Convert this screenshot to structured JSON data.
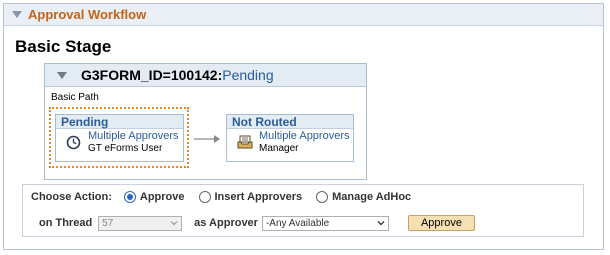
{
  "section": {
    "title": "Approval Workflow"
  },
  "stage": {
    "title": "Basic Stage"
  },
  "path": {
    "id": "G3FORM_ID=100142:",
    "status": "Pending",
    "label": "Basic Path"
  },
  "steps": [
    {
      "status": "Pending",
      "link": "Multiple Approvers",
      "sub": "GT eForms User",
      "icon": "clock-icon"
    },
    {
      "status": "Not Routed",
      "link": "Multiple Approvers",
      "sub": "Manager",
      "icon": "inbox-tray-icon"
    }
  ],
  "action": {
    "choose_label": "Choose Action:",
    "options": [
      "Approve",
      "Insert Approvers",
      "Manage AdHoc"
    ],
    "selected": "Approve",
    "thread_label": "on Thread",
    "thread_value": "57",
    "approver_label": "as Approver",
    "approver_value": "-Any Available",
    "button_label": "Approve"
  },
  "colors": {
    "section_title": "#c2641b",
    "link": "#2a5d9a",
    "dotted_border": "#e58b23",
    "button": "#f5dfb3"
  }
}
